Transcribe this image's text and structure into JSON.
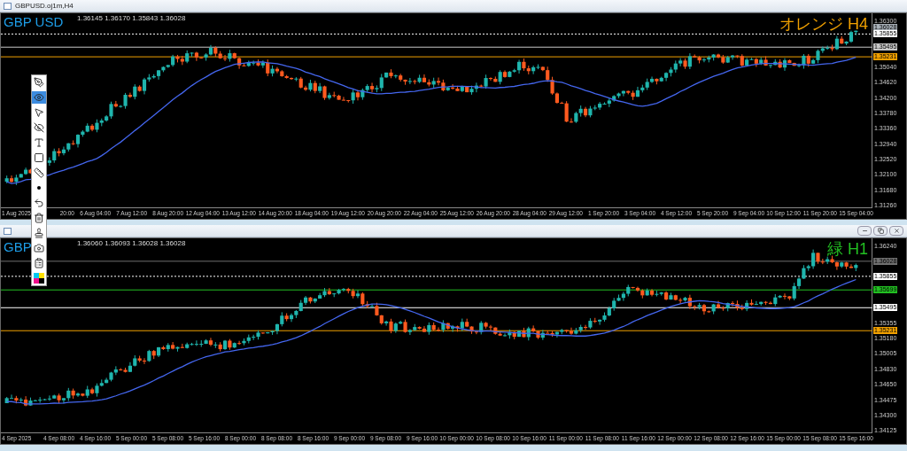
{
  "charts": [
    {
      "title": "GBPUSD.oj1m,H4",
      "ohlc": "1.36145 1.36170 1.35843 1.36028",
      "symbol_label": "GBP USD",
      "note": {
        "text": "オレンジ H4",
        "color": "#f0a000"
      },
      "window_buttons": false,
      "price_ticks": [
        "1.36300",
        "1.35040",
        "1.34620",
        "1.34200",
        "1.33780",
        "1.33360",
        "1.32940",
        "1.32520",
        "1.32100",
        "1.31680",
        "1.31260"
      ],
      "markers": [
        {
          "label": "1.36028",
          "color": "#a8b0b8",
          "kind": "tag"
        },
        {
          "label": "1.35855",
          "color": "#ffffff",
          "kind": "dashed"
        },
        {
          "label": "1.35495",
          "color": "#c8c8c8",
          "kind": "line"
        },
        {
          "label": "1.35231",
          "color": "#f0a000",
          "kind": "line"
        }
      ],
      "time_ticks": [
        "1 Aug 2025",
        "20:00",
        "6 Aug 04:00",
        "7 Aug 12:00",
        "8 Aug 20:00",
        "12 Aug 04:00",
        "13 Aug 12:00",
        "14 Aug 20:00",
        "18 Aug 04:00",
        "19 Aug 12:00",
        "20 Aug 20:00",
        "22 Aug 04:00",
        "25 Aug 12:00",
        "26 Aug 20:00",
        "28 Aug 04:00",
        "29 Aug 12:00",
        "1 Sep 20:00",
        "3 Sep 04:00",
        "4 Sep 12:00",
        "5 Sep 20:00",
        "9 Sep 04:00",
        "10 Sep 12:00",
        "11 Sep 20:00",
        "15 Sep 04:00"
      ]
    },
    {
      "ohlc": "1.36060 1.36093 1.36028 1.36028",
      "symbol_label": "GBP",
      "note": {
        "text": "緑 H1",
        "color": "#22c022"
      },
      "window_buttons": true,
      "price_ticks": [
        "1.36240",
        "1.35355",
        "1.35180",
        "1.35005",
        "1.34830",
        "1.34650",
        "1.34475",
        "1.34300",
        "1.34125"
      ],
      "markers": [
        {
          "label": "1.36028",
          "color": "#707070",
          "kind": "line"
        },
        {
          "label": "1.35855",
          "color": "#ffffff",
          "kind": "dashed"
        },
        {
          "label": "1.35699",
          "color": "#22c022",
          "kind": "line"
        },
        {
          "label": "1.35495",
          "color": "#ffffff",
          "kind": "line"
        },
        {
          "label": "1.35231",
          "color": "#f0a000",
          "kind": "line"
        }
      ],
      "time_ticks": [
        "4 Sep 2025",
        "4 Sep 08:00",
        "4 Sep 16:00",
        "5 Sep 00:00",
        "5 Sep 08:00",
        "5 Sep 16:00",
        "8 Sep 00:00",
        "8 Sep 08:00",
        "8 Sep 16:00",
        "9 Sep 00:00",
        "9 Sep 08:00",
        "9 Sep 16:00",
        "10 Sep 00:00",
        "10 Sep 08:00",
        "10 Sep 16:00",
        "11 Sep 00:00",
        "11 Sep 08:00",
        "11 Sep 16:00",
        "12 Sep 00:00",
        "12 Sep 08:00",
        "12 Sep 16:00",
        "15 Sep 00:00",
        "15 Sep 08:00",
        "15 Sep 16:00"
      ]
    }
  ],
  "drawing_toolbar": {
    "tools": [
      {
        "kind": "pen",
        "selected": false
      },
      {
        "kind": "eye",
        "selected": true
      },
      {
        "kind": "cursor",
        "selected": false
      },
      {
        "kind": "hide",
        "selected": false
      },
      {
        "kind": "text",
        "selected": false
      },
      {
        "kind": "rectangle",
        "selected": false
      },
      {
        "kind": "ruler",
        "selected": false
      },
      {
        "kind": "dot",
        "selected": false
      },
      {
        "kind": "undo",
        "selected": false
      },
      {
        "kind": "trash",
        "selected": false
      },
      {
        "kind": "stamp",
        "selected": false
      },
      {
        "kind": "camera",
        "selected": false
      },
      {
        "kind": "clipboard",
        "selected": false
      },
      {
        "kind": "palette",
        "selected": false
      }
    ]
  }
}
